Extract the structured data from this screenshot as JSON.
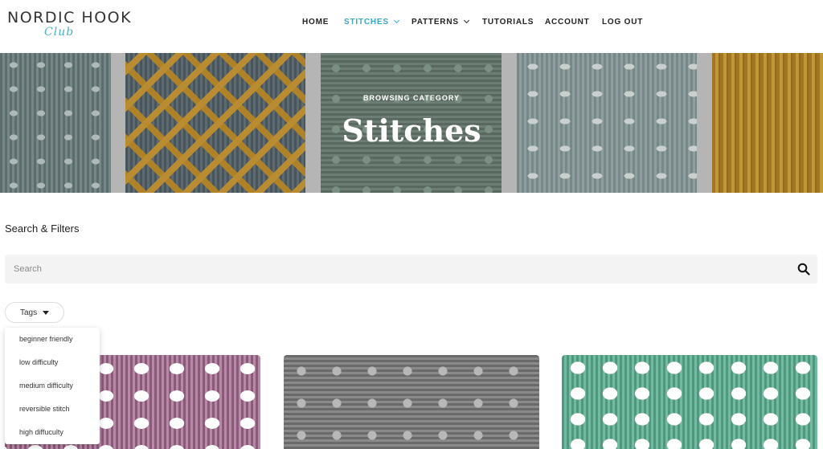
{
  "site": {
    "logo_main": "NORDIC HOOK",
    "logo_sub": "Club"
  },
  "nav": {
    "items": [
      {
        "label": "HOME"
      },
      {
        "label": "STITCHES"
      },
      {
        "label": "PATTERNS"
      },
      {
        "label": "TUTORIALS"
      },
      {
        "label": "ACCOUNT"
      },
      {
        "label": "LOG OUT"
      }
    ],
    "active": "STITCHES",
    "accent_color": "#3aa6c6"
  },
  "hero": {
    "kicker": "BROWSING CATEGORY",
    "title": "Stitches"
  },
  "filters": {
    "title": "Search & Filters",
    "search": {
      "placeholder": "Search",
      "value": ""
    },
    "tags": {
      "label": "Tags",
      "options": [
        {
          "label": "beginner friendly"
        },
        {
          "label": "low difficulty"
        },
        {
          "label": "medium difficulty"
        },
        {
          "label": "reversible stitch"
        },
        {
          "label": "high diffuculty"
        }
      ]
    }
  },
  "icons": {
    "search": "search-icon",
    "dropdown": "caret-down-icon",
    "nav_dropdown": "chevron-down-icon"
  },
  "cards": [
    {
      "color": "#a0708f"
    },
    {
      "color": "#777777"
    },
    {
      "color": "#5fa88e"
    }
  ]
}
